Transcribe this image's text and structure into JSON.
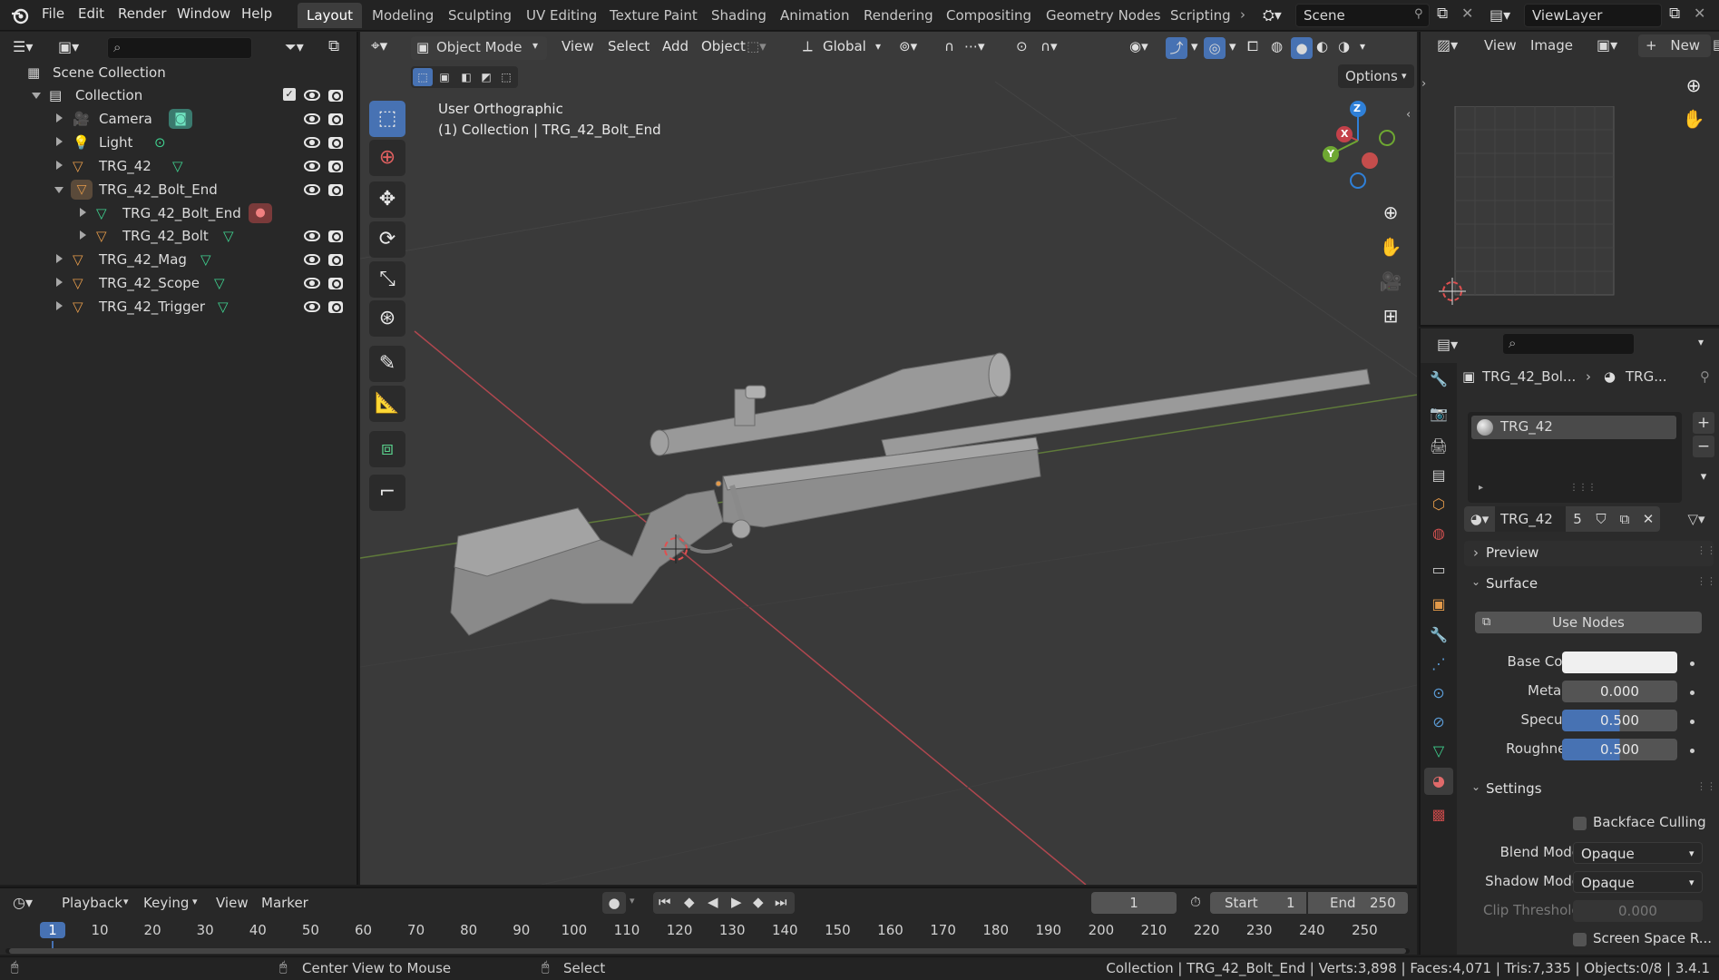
{
  "topbar": {
    "menus": [
      "File",
      "Edit",
      "Render",
      "Window",
      "Help"
    ],
    "workspaces": [
      "Layout",
      "Modeling",
      "Sculpting",
      "UV Editing",
      "Texture Paint",
      "Shading",
      "Animation",
      "Rendering",
      "Compositing",
      "Geometry Nodes",
      "Scripting"
    ],
    "active_workspace": "Layout",
    "scene": "Scene",
    "view_layer": "ViewLayer"
  },
  "outliner": {
    "root": "Scene Collection",
    "items": [
      {
        "label": "Collection",
        "icon": "collection-icon"
      },
      {
        "label": "Camera",
        "icon": "camera-object-icon"
      },
      {
        "label": "Light",
        "icon": "light-object-icon"
      },
      {
        "label": "TRG_42",
        "icon": "mesh-object-icon"
      },
      {
        "label": "TRG_42_Bolt_End",
        "icon": "mesh-object-icon"
      },
      {
        "label": "TRG_42_Bolt_End",
        "icon": "mesh-data-icon"
      },
      {
        "label": "TRG_42_Bolt",
        "icon": "mesh-object-icon"
      },
      {
        "label": "TRG_42_Mag",
        "icon": "mesh-object-icon"
      },
      {
        "label": "TRG_42_Scope",
        "icon": "mesh-object-icon"
      },
      {
        "label": "TRG_42_Trigger",
        "icon": "mesh-object-icon"
      }
    ]
  },
  "viewport": {
    "mode": "Object Mode",
    "menus": [
      "View",
      "Select",
      "Add",
      "Object"
    ],
    "transform_orientation": "Global",
    "options": "Options",
    "view_name": "User Orthographic",
    "view_info": "(1) Collection | TRG_42_Bolt_End",
    "gizmo_axes": {
      "x": "X",
      "y": "Y",
      "z": "Z"
    }
  },
  "image_editor": {
    "menus": [
      "View",
      "Image"
    ],
    "new_label": "New"
  },
  "properties": {
    "breadcrumb_object": "TRG_42_Bol...",
    "breadcrumb_material": "TRG...",
    "material_slot": "TRG_42",
    "material_name": "TRG_42",
    "material_users": "5",
    "sections": {
      "preview": "Preview",
      "surface": "Surface",
      "settings": "Settings"
    },
    "use_nodes": "Use Nodes",
    "base_color_label": "Base Color",
    "base_color": "#f0f0f0",
    "metallic_label": "Metallic",
    "metallic": "0.000",
    "specular_label": "Specular",
    "specular": "0.500",
    "roughness_label": "Roughness",
    "roughness": "0.500",
    "backface_culling": "Backface Culling",
    "blend_mode_label": "Blend Mode",
    "blend_mode": "Opaque",
    "shadow_mode_label": "Shadow Mode",
    "shadow_mode": "Opaque",
    "clip_threshold_label": "Clip Threshold",
    "clip_threshold": "0.000",
    "screen_space": "Screen Space R..."
  },
  "timeline": {
    "menus": [
      "Playback",
      "Keying",
      "View",
      "Marker"
    ],
    "current_frame": "1",
    "start_label": "Start",
    "start": "1",
    "end_label": "End",
    "end": "250",
    "ruler": [
      "1",
      "10",
      "20",
      "30",
      "40",
      "50",
      "60",
      "70",
      "80",
      "90",
      "100",
      "110",
      "120",
      "130",
      "140",
      "150",
      "160",
      "170",
      "180",
      "190",
      "200",
      "210",
      "220",
      "230",
      "240",
      "250"
    ]
  },
  "statusbar": {
    "center_view": "Center View to Mouse",
    "select": "Select",
    "stats": "Collection | TRG_42_Bolt_End | Verts:3,898 | Faces:4,071 | Tris:7,335 | Objects:0/8 | 3.4.1"
  },
  "colors": {
    "accent": "#4772b3",
    "mesh_orange": "#e39a4a",
    "data_green": "#3fd18f",
    "x_axis": "#c4414a",
    "y_axis": "#6ea832",
    "z_axis": "#2f80d8"
  }
}
